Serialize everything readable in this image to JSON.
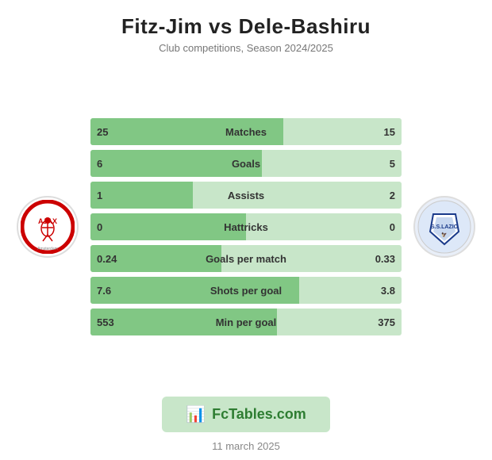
{
  "header": {
    "title": "Fitz-Jim vs Dele-Bashiru",
    "subtitle": "Club competitions, Season 2024/2025"
  },
  "stats": [
    {
      "label": "Matches",
      "left": "25",
      "right": "15",
      "left_pct": 62
    },
    {
      "label": "Goals",
      "left": "6",
      "right": "5",
      "left_pct": 55
    },
    {
      "label": "Assists",
      "left": "1",
      "right": "2",
      "left_pct": 33
    },
    {
      "label": "Hattricks",
      "left": "0",
      "right": "0",
      "left_pct": 50
    },
    {
      "label": "Goals per match",
      "left": "0.24",
      "right": "0.33",
      "left_pct": 42
    },
    {
      "label": "Shots per goal",
      "left": "7.6",
      "right": "3.8",
      "left_pct": 67
    },
    {
      "label": "Min per goal",
      "left": "553",
      "right": "375",
      "left_pct": 60
    }
  ],
  "banner": {
    "icon": "📊",
    "text": "FcTables.com"
  },
  "footer": {
    "date": "11 march 2025"
  },
  "colors": {
    "bar_bg": "#c8e6c9",
    "bar_fill": "#81c784",
    "accent": "#2e7d32"
  }
}
